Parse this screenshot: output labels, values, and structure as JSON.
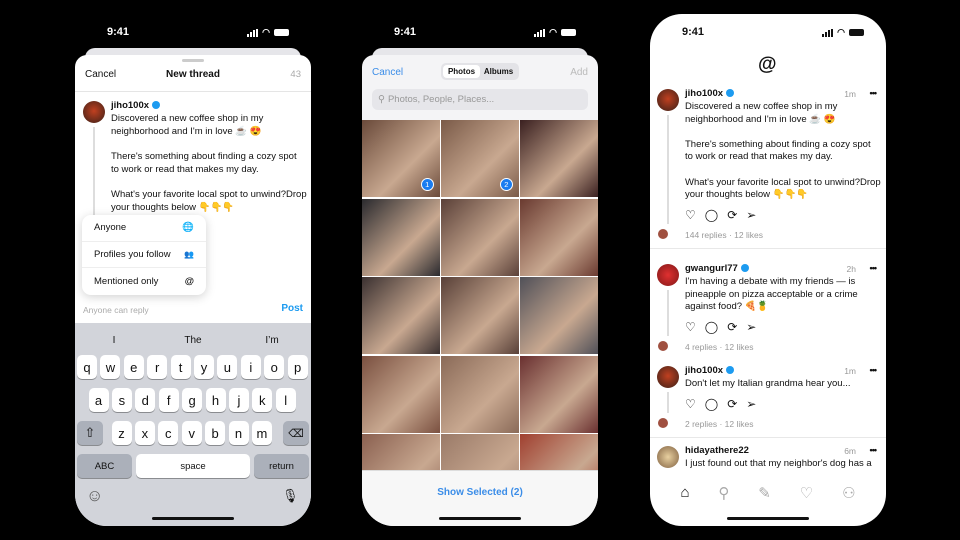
{
  "status_time": "9:41",
  "compose": {
    "cancel": "Cancel",
    "title": "New thread",
    "char_count": "43",
    "username": "jiho100x",
    "lines": [
      "Discovered a new coffee shop in my",
      "neighborhood and I'm in love ☕ 😍",
      "There's something about finding a cozy spot",
      "to work or read that makes my day.",
      "What's your favorite local spot to unwind?Drop",
      "your thoughts below 👇👇👇"
    ],
    "reply_options": [
      {
        "label": "Anyone",
        "icon": "globe-icon",
        "glyph": "🌐"
      },
      {
        "label": "Profiles you follow",
        "icon": "people-icon",
        "glyph": "👥"
      },
      {
        "label": "Mentioned only",
        "icon": "at-icon",
        "glyph": "@"
      }
    ],
    "reply_setting": "Anyone can reply",
    "post": "Post",
    "accent": "#1d9bf0"
  },
  "keyboard": {
    "suggestions": [
      "I",
      "The",
      "I’m"
    ],
    "row1": [
      "q",
      "w",
      "e",
      "r",
      "t",
      "y",
      "u",
      "i",
      "o",
      "p"
    ],
    "row2": [
      "a",
      "s",
      "d",
      "f",
      "g",
      "h",
      "j",
      "k",
      "l"
    ],
    "row3": [
      "z",
      "x",
      "c",
      "v",
      "b",
      "n",
      "m"
    ],
    "shift": "⇧",
    "delete": "⌫",
    "abc": "ABC",
    "space": "space",
    "return": "return",
    "emoji": "☺",
    "mic": "🎙"
  },
  "picker": {
    "cancel": "Cancel",
    "tabs": [
      "Photos",
      "Albums"
    ],
    "active_tab": "Photos",
    "add": "Add",
    "search_placeholder": "Photos, People, Places...",
    "selected_badges": [
      "1",
      "2"
    ],
    "show_selected": "Show Selected (2)"
  },
  "feed": {
    "posts": [
      {
        "user": "jiho100x",
        "verified": true,
        "time": "1m",
        "lines": [
          "Discovered a new coffee shop in my",
          "neighborhood and I'm in love ☕ 😍",
          "",
          "There's something about finding a cozy spot",
          "to work or read that makes my day.",
          "",
          "What's your favorite local spot to unwind?Drop",
          "your thoughts below 👇👇👇"
        ],
        "stats": "144 replies · 12 likes"
      },
      {
        "user": "gwangurl77",
        "verified": true,
        "time": "2h",
        "lines": [
          "I'm having a debate with my friends — is",
          "pineapple on pizza acceptable or a crime",
          "against food? 🍕🍍"
        ],
        "stats": "4 replies · 12 likes"
      },
      {
        "user": "jiho100x",
        "verified": true,
        "time": "1m",
        "lines": [
          "Don't let my Italian grandma hear you..."
        ],
        "stats": "2 replies · 12 likes"
      },
      {
        "user": "hidayathere22",
        "verified": false,
        "time": "6m",
        "lines": [
          "I just found out that my neighbor's dog has a"
        ],
        "stats": ""
      }
    ],
    "more": "•••",
    "actions": [
      "♡",
      "◯",
      "⟳",
      "➢"
    ],
    "nav": [
      "home-icon",
      "search-icon",
      "compose-icon",
      "heart-icon",
      "profile-icon"
    ],
    "nav_glyphs": [
      "⌂",
      "⚲",
      "✎",
      "♡",
      "⚇"
    ]
  }
}
